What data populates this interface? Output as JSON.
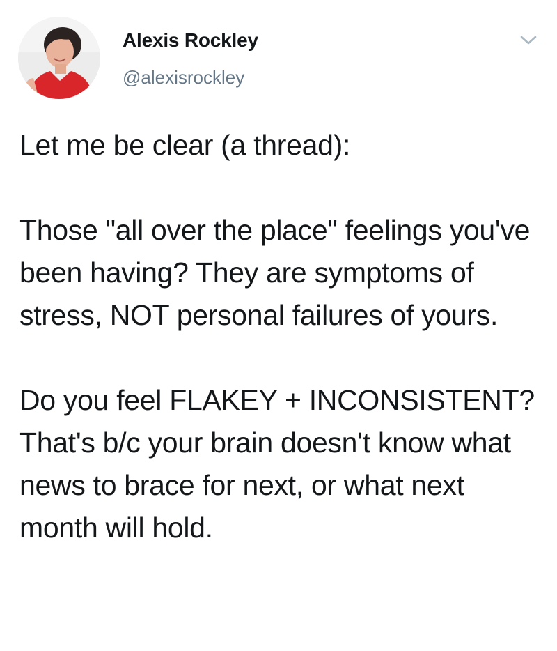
{
  "tweet": {
    "author": {
      "name": "Alexis Rockley",
      "handle": "@alexisrockley"
    },
    "menu_icon": "chevron-down-icon",
    "paragraphs": [
      "Let me be clear (a thread):",
      "Those \"all over the place\" feelings you've been having? They are symptoms of stress, NOT personal failures of yours.",
      "Do you feel FLAKEY + INCONSISTENT? That's b/c your brain doesn't know what news to brace for next, or what next month will hold."
    ]
  },
  "colors": {
    "text": "#14171a",
    "handle": "#657786",
    "caret": "#aab8c2",
    "avatar_shirt": "#d8262b"
  }
}
